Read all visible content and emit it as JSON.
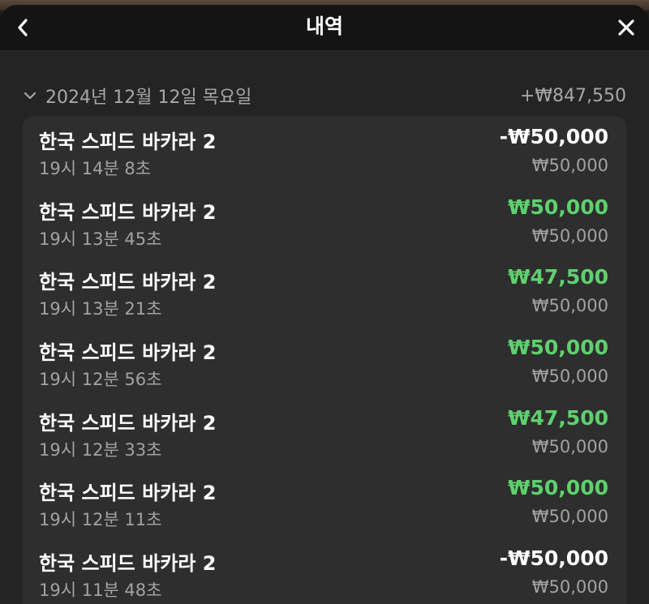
{
  "header": {
    "title": "내역"
  },
  "history": {
    "date_label": "2024년 12월 12일 목요일",
    "total": "+₩847,550",
    "items": [
      {
        "game": "한국 스피드 바카라 2",
        "time": "19시 14분 8초",
        "amount": "-₩50,000",
        "result": "loss",
        "bet": "₩50,000"
      },
      {
        "game": "한국 스피드 바카라 2",
        "time": "19시 13분 45초",
        "amount": "₩50,000",
        "result": "win",
        "bet": "₩50,000"
      },
      {
        "game": "한국 스피드 바카라 2",
        "time": "19시 13분 21초",
        "amount": "₩47,500",
        "result": "win",
        "bet": "₩50,000"
      },
      {
        "game": "한국 스피드 바카라 2",
        "time": "19시 12분 56초",
        "amount": "₩50,000",
        "result": "win",
        "bet": "₩50,000"
      },
      {
        "game": "한국 스피드 바카라 2",
        "time": "19시 12분 33초",
        "amount": "₩47,500",
        "result": "win",
        "bet": "₩50,000"
      },
      {
        "game": "한국 스피드 바카라 2",
        "time": "19시 12분 11초",
        "amount": "₩50,000",
        "result": "win",
        "bet": "₩50,000"
      },
      {
        "game": "한국 스피드 바카라 2",
        "time": "19시 11분 48초",
        "amount": "-₩50,000",
        "result": "loss",
        "bet": "₩50,000"
      }
    ]
  },
  "colors": {
    "win": "#5fd06f",
    "loss": "#ffffff",
    "muted": "#a2a2a2",
    "header_bg": "#141414",
    "card_bg": "#2e2e2e"
  },
  "icons": {
    "back": "chevron-left-icon",
    "close": "close-icon",
    "collapse": "chevron-down-icon"
  }
}
